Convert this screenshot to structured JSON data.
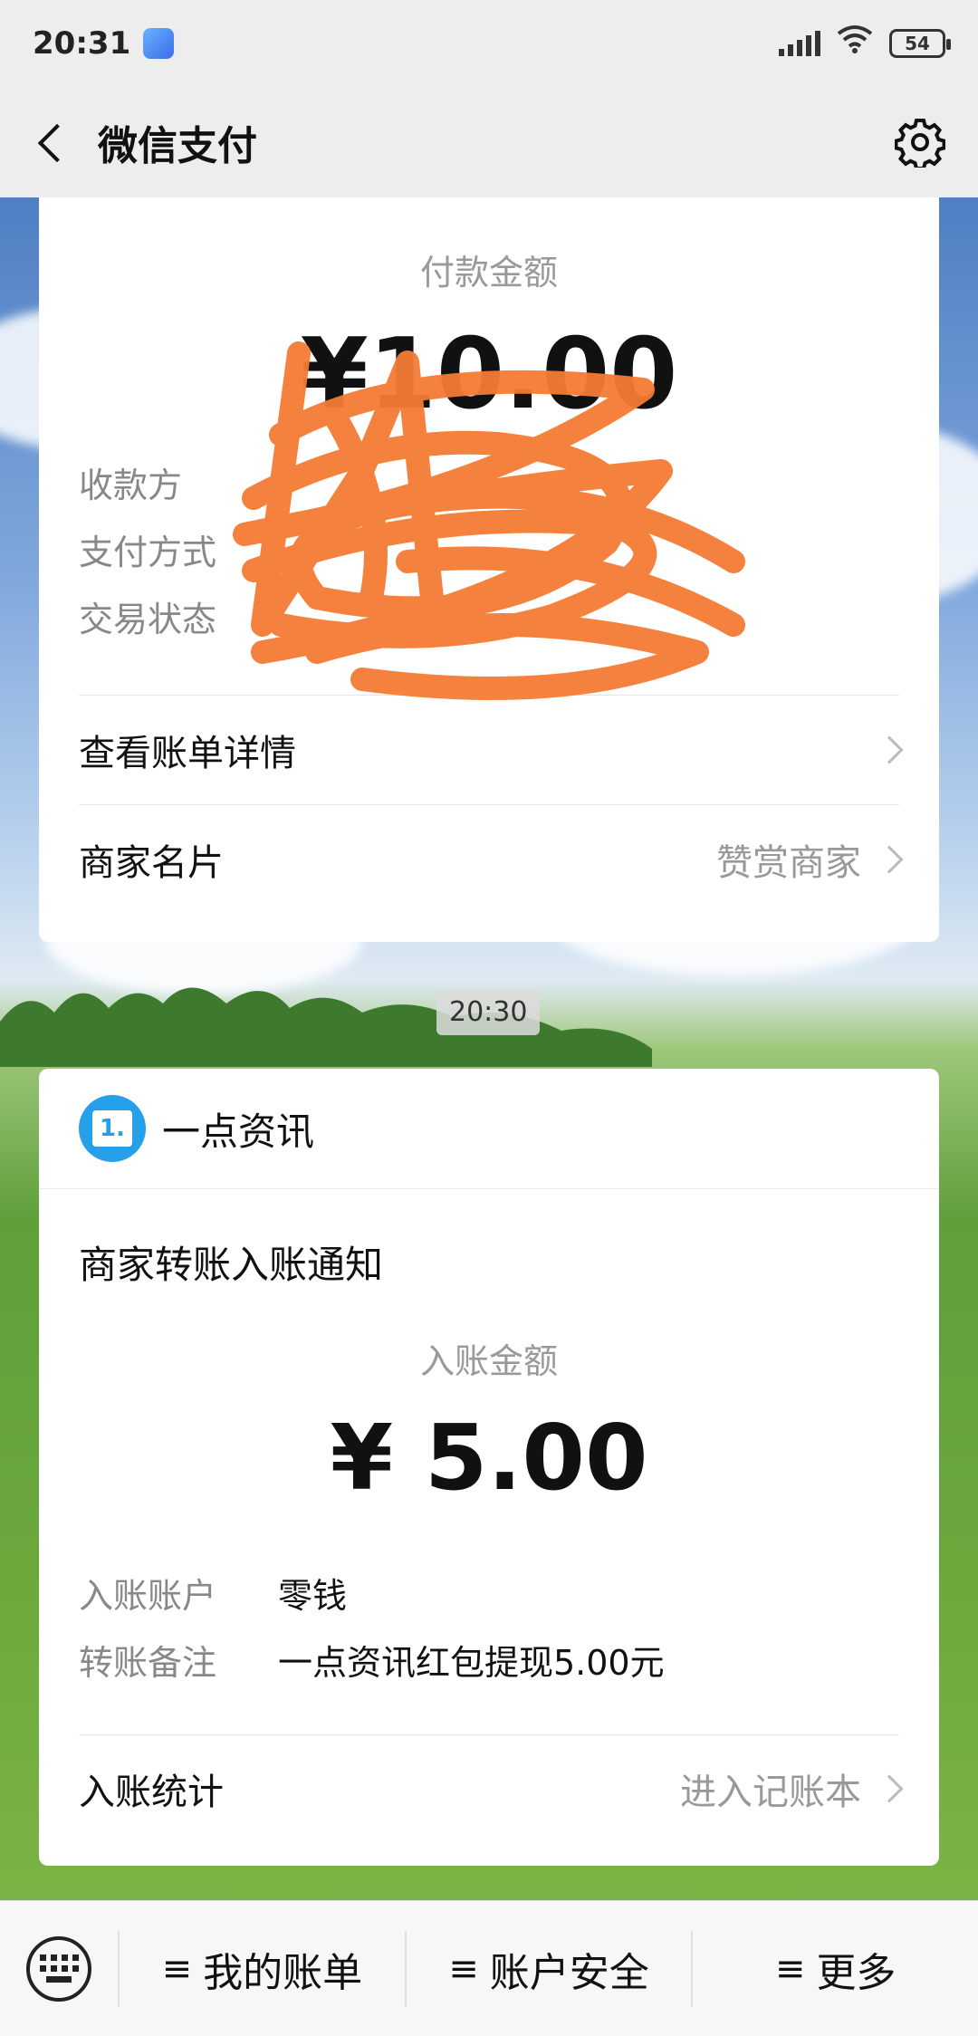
{
  "status": {
    "time": "20:31",
    "battery": "54"
  },
  "nav": {
    "title": "微信支付"
  },
  "payment_card": {
    "amount_label": "付款金额",
    "amount": "¥10.00",
    "rows": [
      {
        "key": "收款方",
        "value": ""
      },
      {
        "key": "支付方式",
        "value": ""
      },
      {
        "key": "交易状态",
        "value": ""
      }
    ],
    "link_bill": "查看账单详情",
    "link_merchant": "商家名片",
    "link_merchant_right": "赞赏商家"
  },
  "timestamp": "20:30",
  "transfer_card": {
    "merchant_name": "一点资讯",
    "merchant_logo_text": "1.",
    "title": "商家转账入账通知",
    "amount_label": "入账金额",
    "amount": "¥ 5.00",
    "rows": [
      {
        "key": "入账账户",
        "value": "零钱"
      },
      {
        "key": "转账备注",
        "value": "一点资讯红包提现5.00元"
      }
    ],
    "stats_label": "入账统计",
    "stats_right": "进入记账本"
  },
  "bottom_menu": {
    "items": [
      "我的账单",
      "账户安全",
      "更多"
    ]
  },
  "colors": {
    "accent": "#27a0ea",
    "scribble": "#f47c34"
  }
}
